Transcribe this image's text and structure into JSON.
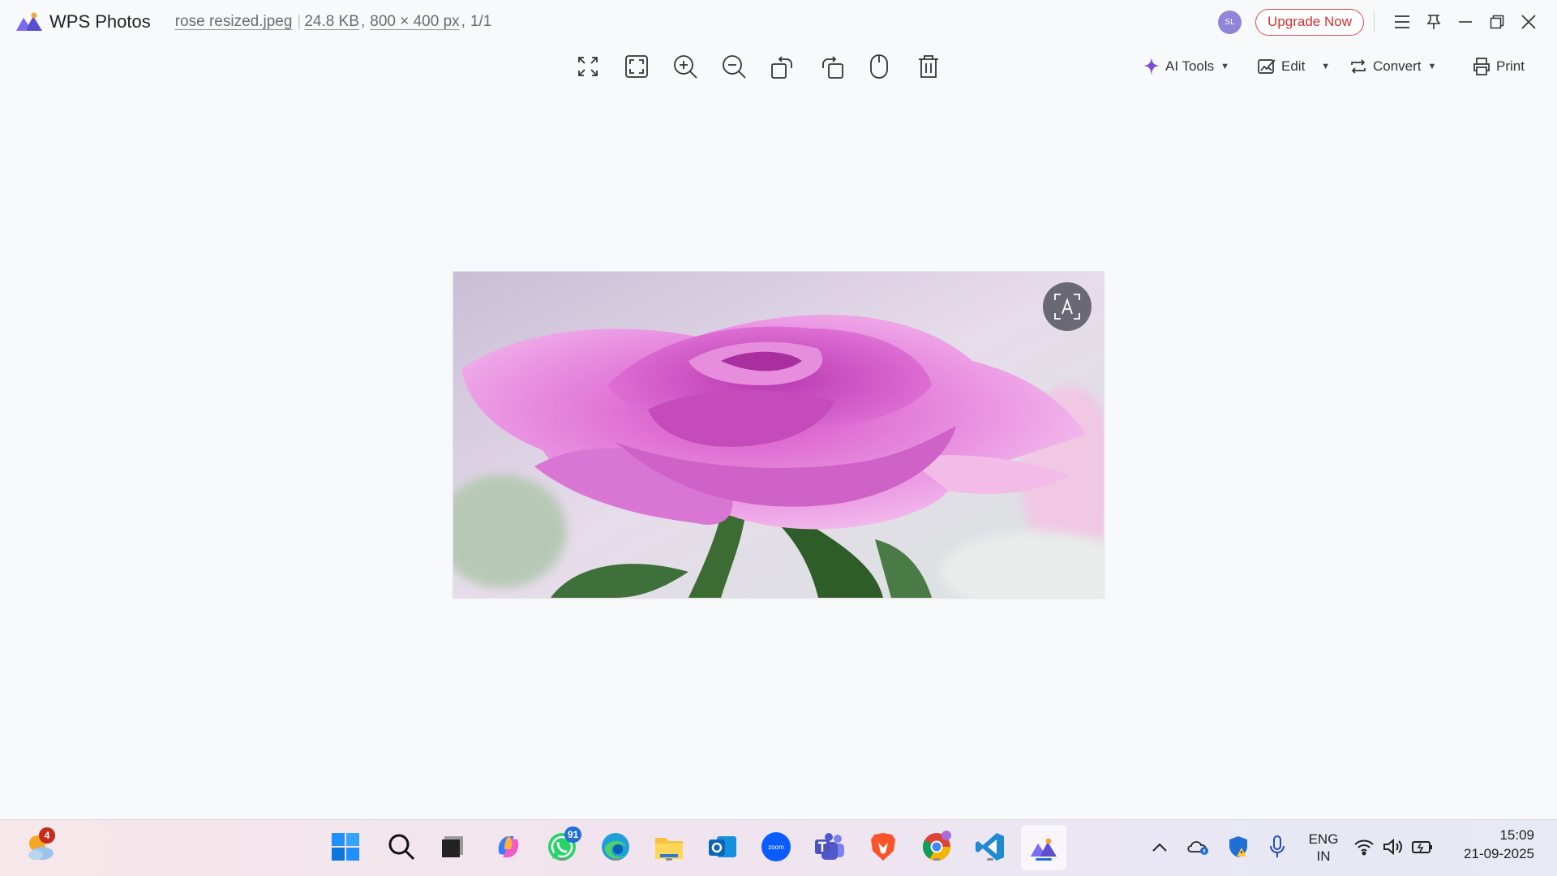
{
  "app": {
    "name": "WPS Photos",
    "file_name": "rose resized.jpeg",
    "file_size": "24.8 KB",
    "dimensions": "800 × 400 px",
    "page_index": "1/1"
  },
  "header": {
    "avatar_initials": "SL",
    "upgrade_label": "Upgrade Now"
  },
  "toolbar": {
    "ai_tools_label": "AI Tools",
    "edit_label": "Edit",
    "convert_label": "Convert",
    "print_label": "Print"
  },
  "taskbar": {
    "weather_badge": "4",
    "whatsapp_badge": "91",
    "language_line1": "ENG",
    "language_line2": "IN",
    "time": "15:09",
    "date": "21-09-2025",
    "zoom_text": "zoom"
  },
  "colors": {
    "accent": "#7b4fd6",
    "upgrade_border": "#e04a4a",
    "taskbar_active": "#1f6fd6"
  }
}
